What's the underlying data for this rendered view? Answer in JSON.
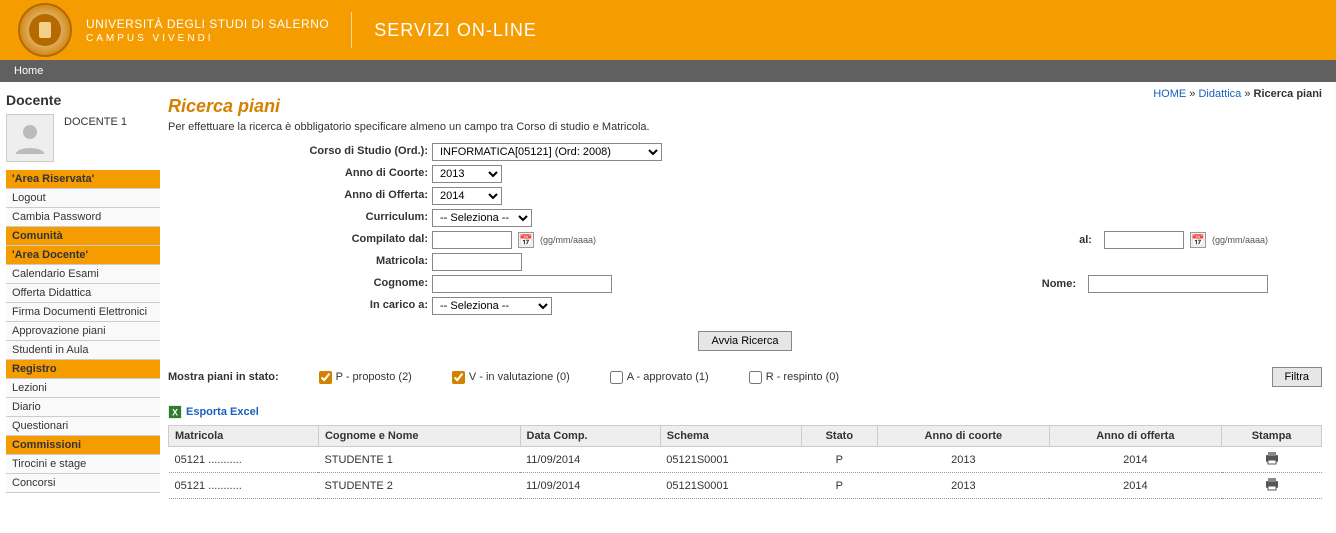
{
  "header": {
    "uni_name": "UNIVERSITÀ DEGLI STUDI DI SALERNO",
    "uni_sub": "CAMPUS VIVENDI",
    "service": "SERVIZI ON-LINE"
  },
  "navbar": {
    "home": "Home"
  },
  "breadcrumb": {
    "home": "HOME",
    "mid": "Didattica",
    "last": "Ricerca piani",
    "sep": "»"
  },
  "sidebar": {
    "title": "Docente",
    "user": "DOCENTE 1",
    "sections": [
      {
        "header": "'Area Riservata'",
        "items": [
          "Logout",
          "Cambia Password"
        ]
      },
      {
        "header": "Comunità",
        "items": []
      },
      {
        "header": "'Area Docente'",
        "items": [
          "Calendario Esami",
          "Offerta Didattica",
          "Firma Documenti Elettronici",
          "Approvazione piani",
          "Studenti in Aula"
        ]
      },
      {
        "header": "Registro",
        "items": [
          "Lezioni",
          "Diario",
          "Questionari"
        ]
      },
      {
        "header": "Commissioni",
        "items": [
          "Tirocini e stage",
          "Concorsi"
        ]
      }
    ]
  },
  "page": {
    "title": "Ricerca piani",
    "desc": "Per effettuare la ricerca è obbligatorio specificare almeno un campo tra Corso di studio e Matricola."
  },
  "form": {
    "labels": {
      "corso": "Corso di Studio (Ord.):",
      "coorte": "Anno di Coorte:",
      "offerta": "Anno di Offerta:",
      "curriculum": "Curriculum:",
      "compilato_dal": "Compilato dal:",
      "al": "al:",
      "matricola": "Matricola:",
      "cognome": "Cognome:",
      "nome": "Nome:",
      "in_carico": "In carico a:"
    },
    "values": {
      "corso": "INFORMATICA[05121] (Ord: 2008)",
      "coorte": "2013",
      "offerta": "2014",
      "curriculum": "-- Seleziona --",
      "compilato_dal": "",
      "al": "",
      "matricola": "",
      "cognome": "",
      "nome": "",
      "in_carico": "-- Seleziona --"
    },
    "date_hint": "(gg/mm/aaaa)",
    "submit": "Avvia Ricerca"
  },
  "filter": {
    "lead": "Mostra piani in stato:",
    "p": "P - proposto (2)",
    "v": "V - in valutazione (0)",
    "a": "A - approvato (1)",
    "r": "R - respinto (0)",
    "btn": "Filtra"
  },
  "export_label": "Esporta Excel",
  "table": {
    "headers": {
      "matricola": "Matricola",
      "cognome": "Cognome e Nome",
      "data": "Data Comp.",
      "schema": "Schema",
      "stato": "Stato",
      "coorte": "Anno di coorte",
      "offerta": "Anno di offerta",
      "stampa": "Stampa"
    },
    "rows": [
      {
        "matricola": "05121 ...........",
        "cognome": "STUDENTE 1",
        "data": "11/09/2014",
        "schema": "05121S0001",
        "stato": "P",
        "coorte": "2013",
        "offerta": "2014"
      },
      {
        "matricola": "05121 ...........",
        "cognome": "STUDENTE 2",
        "data": "11/09/2014",
        "schema": "05121S0001",
        "stato": "P",
        "coorte": "2013",
        "offerta": "2014"
      }
    ]
  }
}
